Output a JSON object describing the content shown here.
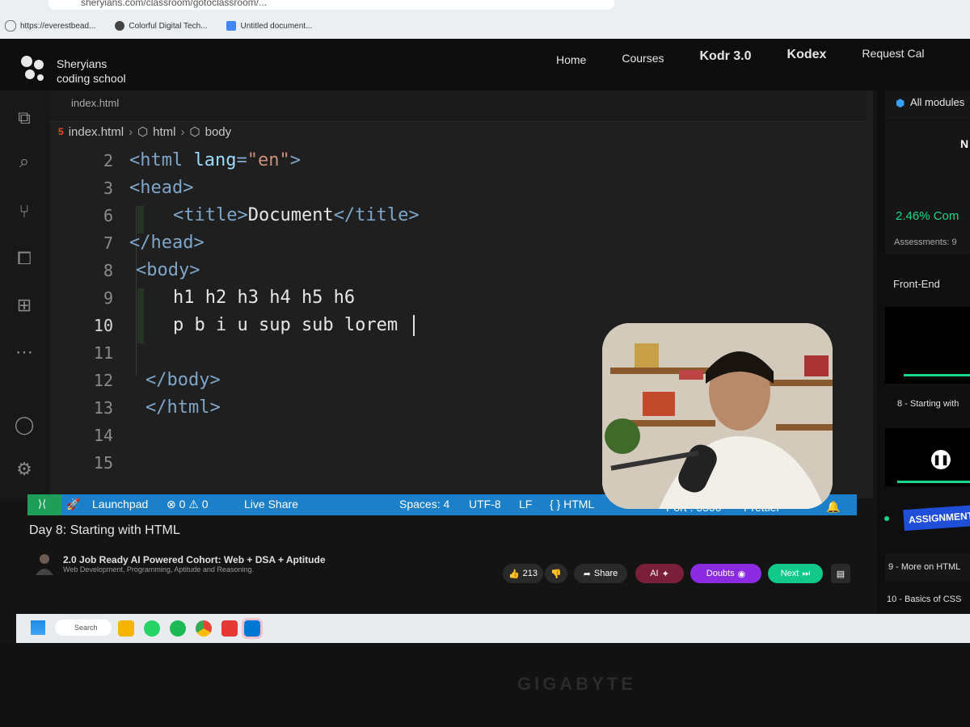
{
  "browser": {
    "url": "sheryians.com/classroom/gotoclassroom/...",
    "bookmarks": [
      {
        "label": "https://everestbead..."
      },
      {
        "label": "Colorful Digital Tech..."
      },
      {
        "label": "Untitled document..."
      }
    ]
  },
  "site": {
    "logo_line1": "Sheryians",
    "logo_line2": "coding school",
    "nav": [
      {
        "label": "Home"
      },
      {
        "label": "Courses"
      },
      {
        "label": "Kodr 3.0"
      },
      {
        "label": "Kodex"
      },
      {
        "label": "Request Cal"
      }
    ]
  },
  "editor": {
    "tab": "index.html",
    "breadcrumb": [
      "index.html",
      "html",
      "body"
    ],
    "lines": [
      {
        "n": "2",
        "parts": [
          [
            "tag",
            "<html "
          ],
          [
            "attr",
            "lang"
          ],
          [
            "tag",
            "="
          ],
          [
            "str",
            "\"en\""
          ],
          [
            "tag",
            ">"
          ]
        ],
        "indent": 0
      },
      {
        "n": "3",
        "parts": [
          [
            "tag",
            "<head>"
          ]
        ],
        "indent": 0
      },
      {
        "n": "6",
        "parts": [
          [
            "tag",
            "<title>"
          ],
          [
            "txt",
            "Document"
          ],
          [
            "tag",
            "</title>"
          ]
        ],
        "indent": 2
      },
      {
        "n": "7",
        "parts": [
          [
            "tag",
            "</head>"
          ]
        ],
        "indent": 0
      },
      {
        "n": "8",
        "parts": [
          [
            "tag",
            "<body>"
          ]
        ],
        "indent": 0
      },
      {
        "n": "9",
        "parts": [
          [
            "txt",
            "h1 h2 h3 h4 h5 h6"
          ]
        ],
        "indent": 2
      },
      {
        "n": "10",
        "parts": [
          [
            "txt",
            "p b i u sup sub lorem "
          ]
        ],
        "indent": 2,
        "cursor": true
      },
      {
        "n": "11",
        "parts": [],
        "indent": 0
      },
      {
        "n": "12",
        "parts": [
          [
            "tag",
            "</body>"
          ]
        ],
        "indent": 0
      },
      {
        "n": "13",
        "parts": [
          [
            "tag",
            "</html>"
          ]
        ],
        "indent": 0
      },
      {
        "n": "14",
        "parts": [],
        "indent": 0
      },
      {
        "n": "15",
        "parts": [],
        "indent": 0
      }
    ]
  },
  "status_bar": {
    "launchpad": "Launchpad",
    "problems": "⊗ 0 ⚠ 0",
    "live_share": "Live Share",
    "spaces": "Spaces: 4",
    "encoding": "UTF-8",
    "eol": "LF",
    "language": "{ } HTML",
    "port": "Port : 5500",
    "prettier": "Prettier"
  },
  "right_panel": {
    "all_modules": "All modules",
    "progress": "2.46% Com",
    "assessments": "Assessments: 9",
    "section": "Front-End",
    "item_8": "8 - Starting with",
    "assignment": "ASSIGNMENT",
    "item_9": "9 - More on HTML",
    "item_10": "10 - Basics of CSS"
  },
  "video": {
    "title": "Day 8: Starting with HTML",
    "course_title": "2.0 Job Ready AI Powered Cohort: Web + DSA + Aptitude",
    "course_sub": "Web Development, Programming, Aptitude and Reasoning.",
    "likes": "213",
    "share": "Share",
    "ai": "AI",
    "doubts": "Doubts",
    "next": "Next"
  },
  "taskbar": {
    "search": "Search"
  },
  "monitor": {
    "brand": "GIGABYTE"
  },
  "colors": {
    "accent_status": "#1b80c9",
    "progress_green": "#19d68a",
    "ai_pill": "#7a1f3a",
    "doubts_pill": "#8a2be2",
    "next_pill": "#13c98a"
  }
}
